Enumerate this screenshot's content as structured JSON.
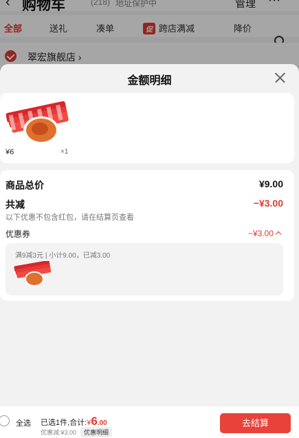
{
  "cart_page": {
    "title": "购物车",
    "count": "(218)",
    "address_protect": "地址保护中",
    "manage": "管理",
    "tabs": [
      {
        "label": "全部"
      },
      {
        "label": "送礼"
      },
      {
        "label": "凑单"
      },
      {
        "label": "跨店满减",
        "badge": "促"
      },
      {
        "label": "降价"
      }
    ],
    "store_name": "翠宏旗舰店 ›"
  },
  "sheet": {
    "title": "金额明细",
    "product": {
      "price": "¥6",
      "quantity": "×1"
    },
    "goods_total_label": "商品总价",
    "goods_total_value": "¥9.00",
    "total_discount_label": "共减",
    "total_discount_value": "−¥3.00",
    "discount_note": "以下优惠不包含红包，请在结算页查看",
    "coupon_label": "优惠券",
    "coupon_value": "−¥3.00",
    "coupon_desc": "满9减3元 | 小计9.00，已减3.00"
  },
  "bottom_bar": {
    "select_all": "全选",
    "selected_text": "已选1件,合计:",
    "total_symbol": "¥",
    "total_int": "6",
    "total_dec": ".00",
    "discount_text": "优惠减:¥3.00",
    "detail_tag": "优惠明细",
    "checkout": "去结算"
  },
  "colors": {
    "accent": "#e23a2e",
    "checkout_bg": "#e8423a"
  },
  "icons": [
    "back-icon",
    "more-icon",
    "search-icon",
    "check-icon",
    "close-icon",
    "chevron-up-icon"
  ]
}
